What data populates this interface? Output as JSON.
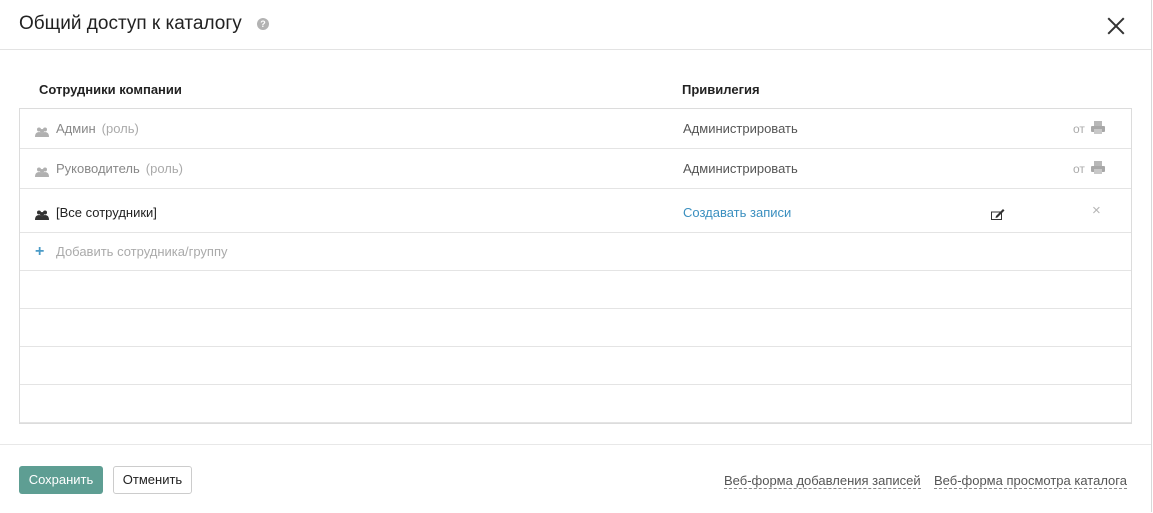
{
  "dialog": {
    "title": "Общий доступ к каталогу",
    "help_icon": "?"
  },
  "columns": {
    "employees": "Сотрудники компании",
    "privilege": "Привилегия"
  },
  "rows": [
    {
      "name": "Админ",
      "tag": "(роль)",
      "privilege": "Администрировать",
      "owner_label": "от",
      "icon": "people-icon"
    },
    {
      "name": "Руководитель",
      "tag": "(роль)",
      "privilege": "Администрировать",
      "owner_label": "от",
      "icon": "people-icon"
    },
    {
      "name": "[Все сотрудники]",
      "privilege": "Создавать записи",
      "icon": "people-icon",
      "remove": "×"
    }
  ],
  "add_row": {
    "icon": "+",
    "label": "Добавить сотрудника/группу"
  },
  "footer": {
    "save": "Сохранить",
    "cancel": "Отменить",
    "link_add_form": "Веб-форма добавления записей",
    "link_view_form": "Веб-форма просмотра каталога"
  },
  "colors": {
    "accent": "#5e9e93",
    "link": "#3a8fbf",
    "muted": "#9a9a9a"
  }
}
